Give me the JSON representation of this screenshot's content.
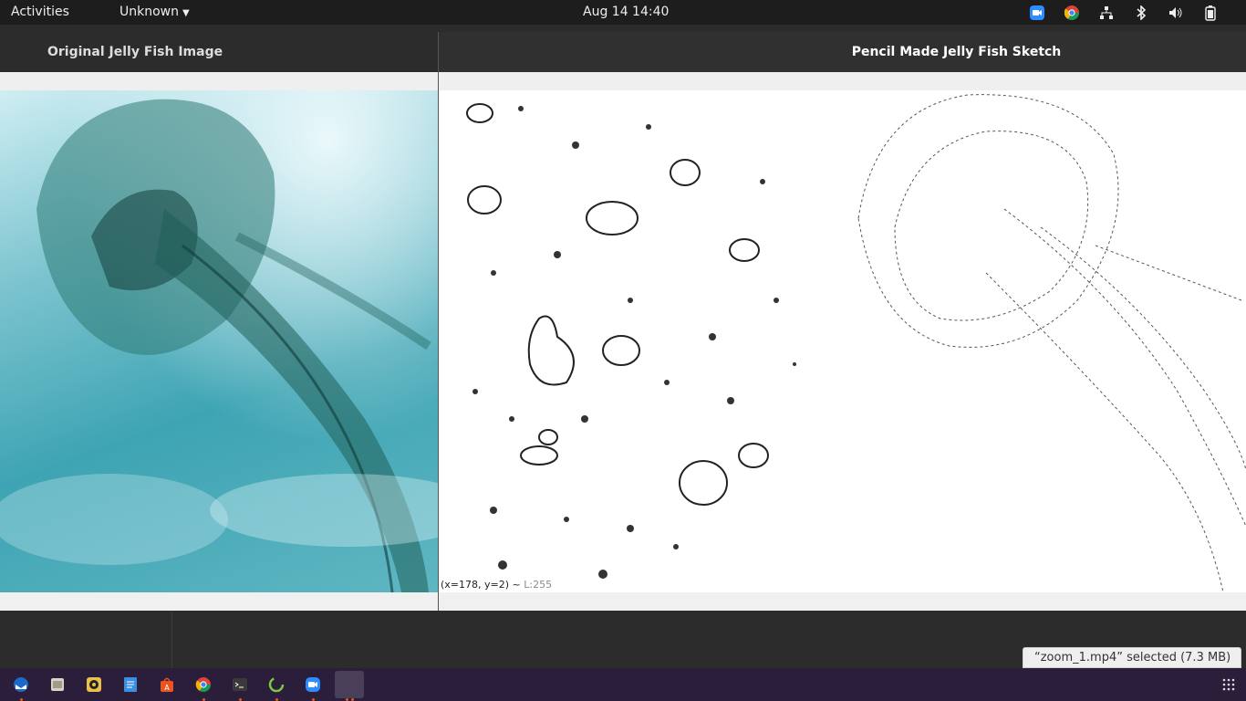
{
  "topbar": {
    "activities": "Activities",
    "app_menu": "Unknown",
    "clock": "Aug 14  14:40",
    "tray_icons": [
      "zoom-icon",
      "chrome-icon",
      "network-icon",
      "bluetooth-icon",
      "volume-icon",
      "battery-icon"
    ]
  },
  "windows": {
    "original": {
      "title": "Original Jelly Fish Image"
    },
    "sketch": {
      "title": "Pencil Made Jelly Fish Sketch",
      "status_coords": "(x=178, y=2) ~ ",
      "status_value": "L:255"
    }
  },
  "notification": {
    "text": "“zoom_1.mp4” selected  (7.3 MB)"
  },
  "dock": {
    "apps": [
      "thunderbird-icon",
      "files-icon",
      "rhythmbox-icon",
      "text-editor-icon",
      "software-icon",
      "chrome-icon",
      "terminal-icon",
      "updater-icon",
      "zoom-icon",
      "app-window-icon"
    ]
  },
  "colors": {
    "accent": "#e95420",
    "dock_bg": "#2b1e3a",
    "topbar_bg": "#1d1d1d"
  }
}
